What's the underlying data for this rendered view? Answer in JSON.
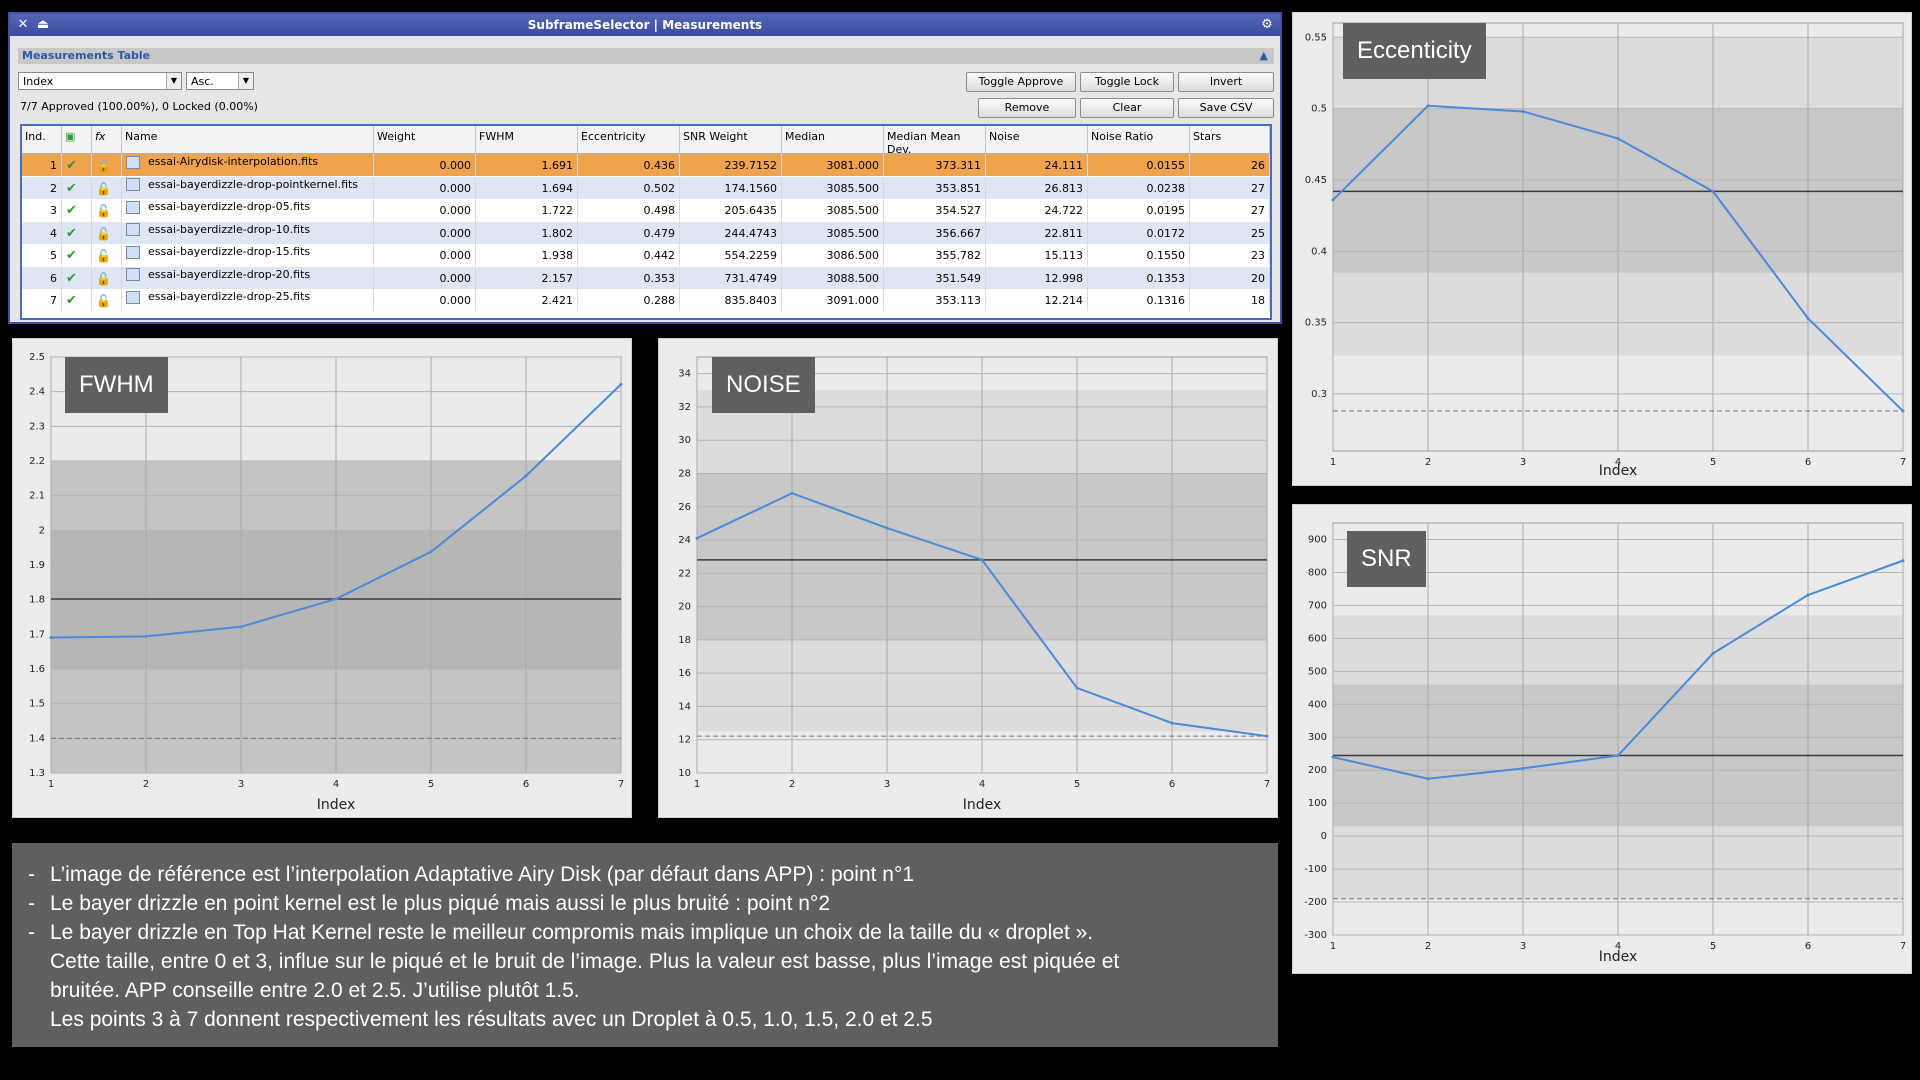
{
  "window": {
    "title": "SubframeSelector | Measurements",
    "section_title": "Measurements Table",
    "sort_field": "Index",
    "sort_order": "Asc.",
    "summary": "7/7 Approved (100.00%), 0 Locked (0.00%)",
    "buttons": {
      "toggle_approve": "Toggle Approve",
      "toggle_lock": "Toggle Lock",
      "invert": "Invert",
      "remove": "Remove",
      "clear": "Clear",
      "save_csv": "Save CSV"
    }
  },
  "table": {
    "headers": [
      "Ind.",
      "",
      "",
      "Name",
      "Weight",
      "FWHM",
      "Eccentricity",
      "SNR Weight",
      "Median",
      "Median Mean Dev.",
      "Noise",
      "Noise Ratio",
      "Stars"
    ],
    "rows": [
      [
        "1",
        "essai-Airydisk-interpolation.fits",
        "0.000",
        "1.691",
        "0.436",
        "239.7152",
        "3081.000",
        "373.311",
        "24.111",
        "0.0155",
        "26"
      ],
      [
        "2",
        "essai-bayerdizzle-drop-pointkernel.fits",
        "0.000",
        "1.694",
        "0.502",
        "174.1560",
        "3085.500",
        "353.851",
        "26.813",
        "0.0238",
        "27"
      ],
      [
        "3",
        "essai-bayerdizzle-drop-05.fits",
        "0.000",
        "1.722",
        "0.498",
        "205.6435",
        "3085.500",
        "354.527",
        "24.722",
        "0.0195",
        "27"
      ],
      [
        "4",
        "essai-bayerdizzle-drop-10.fits",
        "0.000",
        "1.802",
        "0.479",
        "244.4743",
        "3085.500",
        "356.667",
        "22.811",
        "0.0172",
        "25"
      ],
      [
        "5",
        "essai-bayerdizzle-drop-15.fits",
        "0.000",
        "1.938",
        "0.442",
        "554.2259",
        "3086.500",
        "355.782",
        "15.113",
        "0.1550",
        "23"
      ],
      [
        "6",
        "essai-bayerdizzle-drop-20.fits",
        "0.000",
        "2.157",
        "0.353",
        "731.4749",
        "3088.500",
        "351.549",
        "12.998",
        "0.1353",
        "20"
      ],
      [
        "7",
        "essai-bayerdizzle-drop-25.fits",
        "0.000",
        "2.421",
        "0.288",
        "835.8403",
        "3091.000",
        "353.113",
        "12.214",
        "0.1316",
        "18"
      ]
    ],
    "colors": {
      "selected_row": "#f0a24c",
      "alt_row": "#dfe6f3",
      "approved_check": "#2e9b2e",
      "lock": "#e08a1c"
    }
  },
  "charts": {
    "fwhm": {
      "label": "FWHM",
      "xlabel": "Index"
    },
    "noise": {
      "label": "NOISE",
      "xlabel": "Index"
    },
    "ecc": {
      "label": "Eccenticity",
      "xlabel": "Index"
    },
    "snr": {
      "label": "SNR",
      "xlabel": "Index"
    }
  },
  "chart_data": [
    {
      "type": "line",
      "id": "fwhm",
      "title": "FWHM",
      "xlabel": "Index",
      "ylabel": "",
      "x": [
        1,
        2,
        3,
        4,
        5,
        6,
        7
      ],
      "series": [
        {
          "values": [
            1.691,
            1.694,
            1.722,
            1.802,
            1.938,
            2.157,
            2.421
          ]
        }
      ],
      "xlim": [
        1,
        7
      ],
      "ylim": [
        1.3,
        2.5
      ],
      "yticks": [
        "1.3",
        "1.4",
        "1.5",
        "1.6",
        "1.7",
        "1.8",
        "1.9",
        "2",
        "2.1",
        "2.2",
        "2.3",
        "2.4",
        "2.5"
      ],
      "xticks": [
        "1",
        "2",
        "3",
        "4",
        "5",
        "6",
        "7"
      ],
      "median": 1.802,
      "min_line": 1.4,
      "bands": [
        [
          1.2,
          2.2,
          "#c4c4c4"
        ],
        [
          1.6,
          2.0,
          "#b6b6b6"
        ]
      ]
    },
    {
      "type": "line",
      "id": "noise",
      "title": "NOISE",
      "xlabel": "Index",
      "ylabel": "",
      "x": [
        1,
        2,
        3,
        4,
        5,
        6,
        7
      ],
      "series": [
        {
          "values": [
            24.111,
            26.813,
            24.722,
            22.811,
            15.113,
            12.998,
            12.214
          ]
        }
      ],
      "xlim": [
        1,
        7
      ],
      "ylim": [
        10,
        35
      ],
      "yticks": [
        "10",
        "12",
        "14",
        "16",
        "18",
        "20",
        "22",
        "24",
        "26",
        "28",
        "30",
        "32",
        "34"
      ],
      "xticks": [
        "1",
        "2",
        "3",
        "4",
        "5",
        "6",
        "7"
      ],
      "median": 22.811,
      "min_line": 12.214,
      "bands": [
        [
          12.5,
          33,
          "#dcdcdc"
        ],
        [
          18,
          28,
          "#c8c8c8"
        ]
      ]
    },
    {
      "type": "line",
      "id": "ecc",
      "title": "Eccenticity",
      "xlabel": "Index",
      "ylabel": "",
      "x": [
        1,
        2,
        3,
        4,
        5,
        6,
        7
      ],
      "series": [
        {
          "values": [
            0.436,
            0.502,
            0.498,
            0.479,
            0.442,
            0.353,
            0.288
          ]
        }
      ],
      "xlim": [
        1,
        7
      ],
      "ylim": [
        0.26,
        0.56
      ],
      "yticks": [
        "0.3",
        "0.35",
        "0.4",
        "0.45",
        "0.5",
        "0.55"
      ],
      "xticks": [
        "1",
        "2",
        "3",
        "4",
        "5",
        "6",
        "7"
      ],
      "median": 0.442,
      "min_line": 0.288,
      "bands": [
        [
          0.327,
          0.55,
          "#dcdcdc"
        ],
        [
          0.385,
          0.5,
          "#c8c8c8"
        ]
      ]
    },
    {
      "type": "line",
      "id": "snr",
      "title": "SNR",
      "xlabel": "Index",
      "ylabel": "",
      "x": [
        1,
        2,
        3,
        4,
        5,
        6,
        7
      ],
      "series": [
        {
          "values": [
            239.7152,
            174.156,
            205.6435,
            244.4743,
            554.2259,
            731.4749,
            835.8403
          ]
        }
      ],
      "xlim": [
        1,
        7
      ],
      "ylim": [
        -300,
        950
      ],
      "yticks": [
        "-300",
        "-200",
        "-100",
        "0",
        "100",
        "200",
        "300",
        "400",
        "500",
        "600",
        "700",
        "800",
        "900"
      ],
      "xticks": [
        "1",
        "2",
        "3",
        "4",
        "5",
        "6",
        "7"
      ],
      "median": 244.4743,
      "min_line": -190,
      "bands": [
        [
          -190,
          670,
          "#dcdcdc"
        ],
        [
          30,
          460,
          "#c8c8c8"
        ]
      ]
    }
  ],
  "notes": [
    "L’image de référence est l’interpolation Adaptative Airy Disk (par défaut dans APP) : point n°1",
    "Le bayer drizzle en point kernel est le plus piqué mais aussi le plus bruité : point n°2",
    "Le bayer drizzle en Top Hat Kernel reste le meilleur compromis mais implique un choix de la taille du « droplet ».",
    "Cette taille, entre 0 et 3, influe sur le piqué et le bruit de l’image. Plus la valeur est basse, plus l’image est piquée et",
    "bruitée. APP conseille entre 2.0 et 2.5. J’utilise plutôt 1.5.",
    "Les points 3 à 7 donnent respectivement les résultats avec un Droplet à 0.5, 1.0, 1.5, 2.0 et 2.5"
  ],
  "note_dash": "-"
}
